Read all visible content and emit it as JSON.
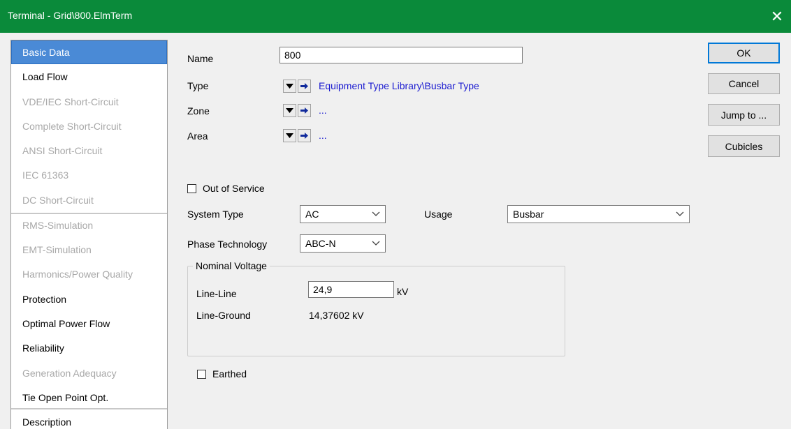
{
  "window": {
    "title": "Terminal - Grid\\800.ElmTerm"
  },
  "sidebar": {
    "items": [
      {
        "label": "Basic Data"
      },
      {
        "label": "Load Flow"
      },
      {
        "label": "VDE/IEC Short-Circuit"
      },
      {
        "label": "Complete Short-Circuit"
      },
      {
        "label": "ANSI Short-Circuit"
      },
      {
        "label": "IEC 61363"
      },
      {
        "label": "DC Short-Circuit"
      },
      {
        "label": "RMS-Simulation"
      },
      {
        "label": "EMT-Simulation"
      },
      {
        "label": "Harmonics/Power Quality"
      },
      {
        "label": "Protection"
      },
      {
        "label": "Optimal Power Flow"
      },
      {
        "label": "Reliability"
      },
      {
        "label": "Generation Adequacy"
      },
      {
        "label": "Tie Open Point Opt."
      },
      {
        "label": "Description"
      }
    ]
  },
  "form": {
    "name_label": "Name",
    "name_value": "800",
    "type_label": "Type",
    "type_link": "Equipment Type Library\\Busbar Type",
    "zone_label": "Zone",
    "zone_link": "...",
    "area_label": "Area",
    "area_link": "...",
    "out_of_service_label": "Out of Service",
    "system_type_label": "System Type",
    "system_type_value": "AC",
    "usage_label": "Usage",
    "usage_value": "Busbar",
    "phase_tech_label": "Phase Technology",
    "phase_tech_value": "ABC-N",
    "nominal_voltage": {
      "title": "Nominal Voltage",
      "line_line_label": "Line-Line",
      "line_line_value": "24,9",
      "line_line_unit": "kV",
      "line_ground_label": "Line-Ground",
      "line_ground_value": "14,37602 kV"
    },
    "earthed_label": "Earthed"
  },
  "buttons": {
    "ok": "OK",
    "cancel": "Cancel",
    "jump_to": "Jump to ...",
    "cubicles": "Cubicles"
  },
  "colors": {
    "titlebar": "#0a8a3a",
    "selected_item": "#4a8ad6",
    "link": "#1a1ad0"
  }
}
